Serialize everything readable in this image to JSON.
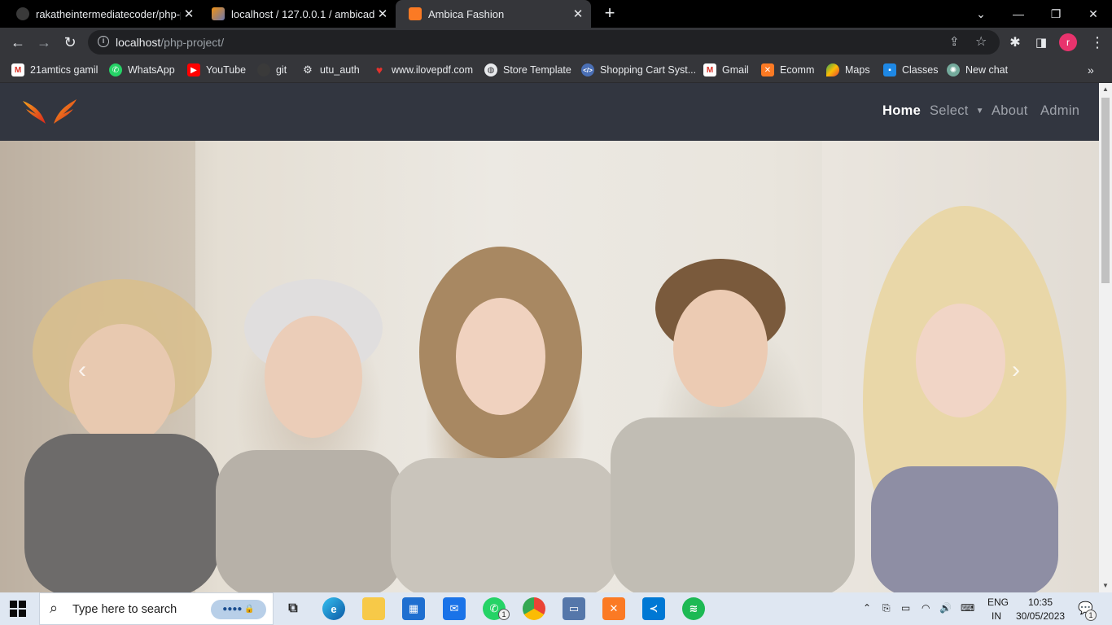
{
  "browser": {
    "tabs": [
      {
        "title": "rakatheintermediatecoder/php-p",
        "icon": "github-icon",
        "active": false
      },
      {
        "title": "localhost / 127.0.0.1 / ambicadb /",
        "icon": "phpmyadmin-icon",
        "active": false
      },
      {
        "title": "Ambica Fashion",
        "icon": "xampp-icon",
        "active": true
      }
    ],
    "url_host": "localhost",
    "url_path": "/php-project/",
    "profile_initial": "r",
    "bookmarks": [
      {
        "label": "21amtics gamil",
        "icon": "gmail-icon"
      },
      {
        "label": "WhatsApp",
        "icon": "whatsapp-icon"
      },
      {
        "label": "YouTube",
        "icon": "youtube-icon"
      },
      {
        "label": "git",
        "icon": "github-icon"
      },
      {
        "label": "utu_auth",
        "icon": "gear-icon"
      },
      {
        "label": "www.ilovepdf.com",
        "icon": "heart-icon"
      },
      {
        "label": "Store Template",
        "icon": "globe-icon"
      },
      {
        "label": "Shopping Cart Syst...",
        "icon": "code-icon"
      },
      {
        "label": "Gmail",
        "icon": "gmail-icon"
      },
      {
        "label": "Ecomm",
        "icon": "xampp-icon"
      },
      {
        "label": "Maps",
        "icon": "maps-icon"
      },
      {
        "label": "Classes",
        "icon": "classroom-icon"
      },
      {
        "label": "New chat",
        "icon": "chatgpt-icon"
      }
    ]
  },
  "site": {
    "nav": {
      "home": "Home",
      "select": "Select",
      "about": "About",
      "admin": "Admin"
    },
    "carousel": {
      "prev_glyph": "‹",
      "next_glyph": "›"
    }
  },
  "taskbar": {
    "search_placeholder": "Type here to search",
    "whatsapp_badge": "1",
    "lang_top": "ENG",
    "lang_bottom": "IN",
    "time": "10:35",
    "date": "30/05/2023",
    "notification_count": "1"
  },
  "colors": {
    "navbar": "#323640",
    "active_link": "#ffffff",
    "inactive_link": "#9fa3ab",
    "taskbar": "#dfe7f2"
  }
}
